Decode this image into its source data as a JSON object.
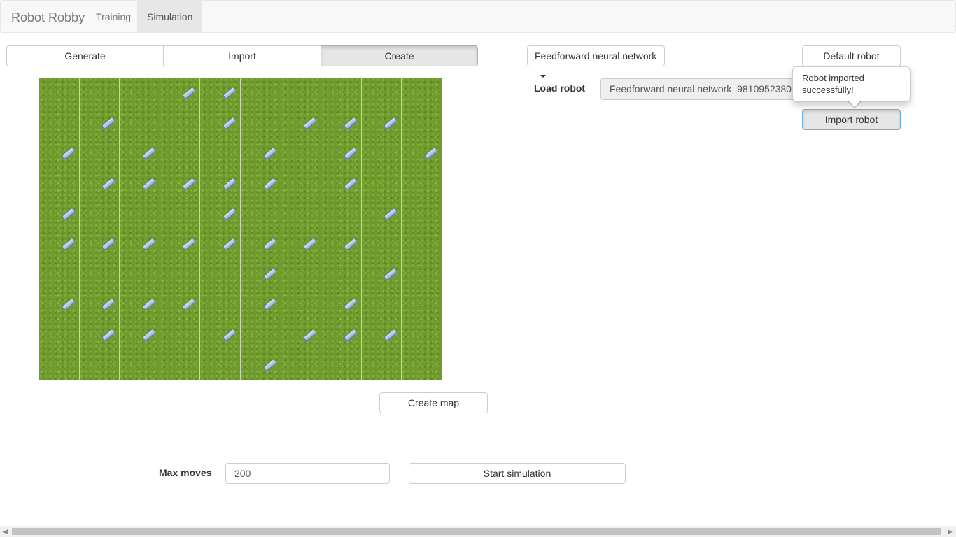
{
  "navbar": {
    "brand": "Robot Robby",
    "tabs": [
      {
        "label": "Training"
      },
      {
        "label": "Simulation"
      }
    ]
  },
  "map_mode": {
    "generate": "Generate",
    "import": "Import",
    "create": "Create"
  },
  "grid": {
    "rows": 10,
    "cols": 10,
    "cans": [
      [
        0,
        0,
        0,
        1,
        1,
        0,
        0,
        0,
        0,
        0
      ],
      [
        0,
        1,
        0,
        0,
        1,
        0,
        1,
        1,
        1,
        0
      ],
      [
        1,
        0,
        1,
        0,
        0,
        1,
        0,
        1,
        0,
        1
      ],
      [
        0,
        1,
        1,
        1,
        1,
        1,
        0,
        1,
        0,
        0
      ],
      [
        1,
        0,
        0,
        0,
        1,
        0,
        0,
        0,
        1,
        0
      ],
      [
        1,
        1,
        1,
        1,
        1,
        1,
        1,
        1,
        0,
        0
      ],
      [
        0,
        0,
        0,
        0,
        0,
        1,
        0,
        0,
        1,
        0
      ],
      [
        1,
        1,
        1,
        1,
        0,
        1,
        0,
        1,
        0,
        0
      ],
      [
        0,
        1,
        1,
        0,
        1,
        0,
        1,
        1,
        1,
        0
      ],
      [
        0,
        0,
        0,
        0,
        0,
        1,
        0,
        0,
        0,
        0
      ]
    ]
  },
  "create_map_button": "Create map",
  "robot": {
    "type_selected": "Feedforward neural network",
    "default_button": "Default robot",
    "load_label": "Load robot",
    "load_value": "Feedforward neural network_98109523809523",
    "import_button": "Import robot",
    "popover_text": "Robot imported successfully!"
  },
  "simulation": {
    "max_moves_label": "Max moves",
    "max_moves_value": "200",
    "start_button": "Start simulation"
  },
  "scrollbar": {
    "left_arrow": "◀",
    "right_arrow": "▶"
  }
}
